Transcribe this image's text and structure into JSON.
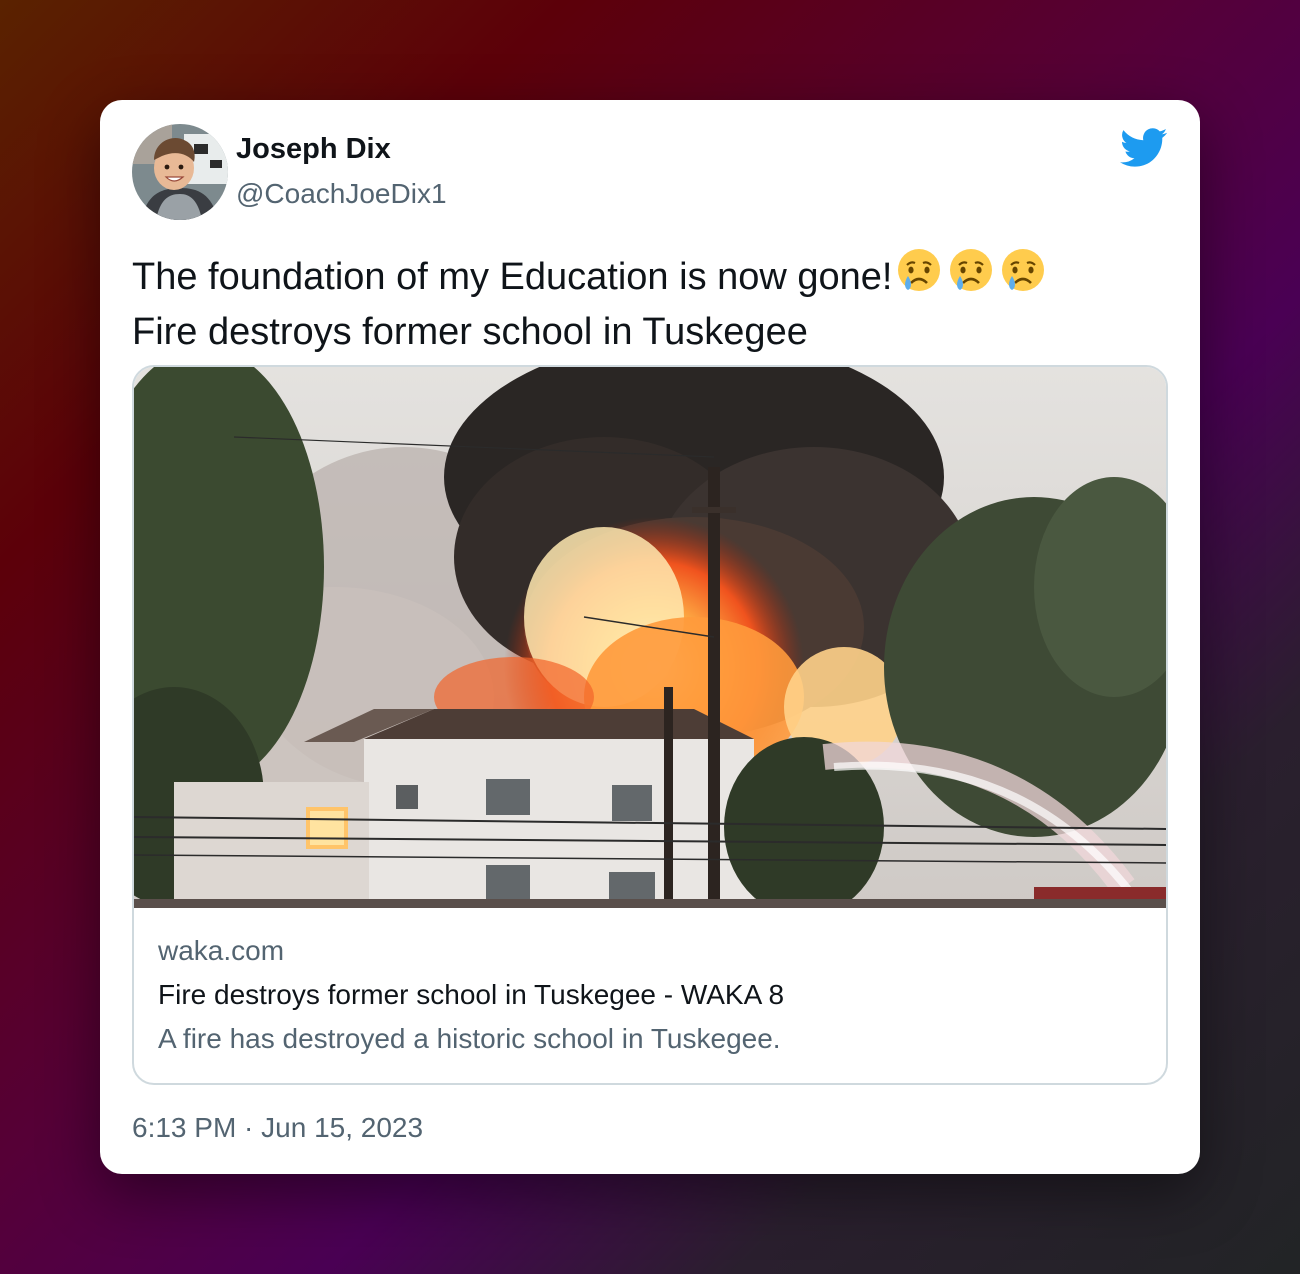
{
  "author": {
    "name": "Joseph Dix",
    "handle": "@CoachJoeDix1"
  },
  "tweet": {
    "line1": "The foundation of my Education is now gone!",
    "emojis": [
      "crying-face-emoji",
      "crying-face-emoji",
      "crying-face-emoji"
    ],
    "line2": "Fire destroys former school in Tuskegee"
  },
  "link_card": {
    "domain": "waka.com",
    "title": "Fire destroys former school in Tuskegee - WAKA 8",
    "description": "A fire has destroyed a historic school in Tuskegee."
  },
  "timestamp": "6:13 PM · Jun 15, 2023",
  "colors": {
    "twitter_blue": "#1d9bf0",
    "text_primary": "#0f1419",
    "text_secondary": "#536471",
    "border": "#cfd9de"
  },
  "icons": [
    "twitter-bird-icon"
  ]
}
